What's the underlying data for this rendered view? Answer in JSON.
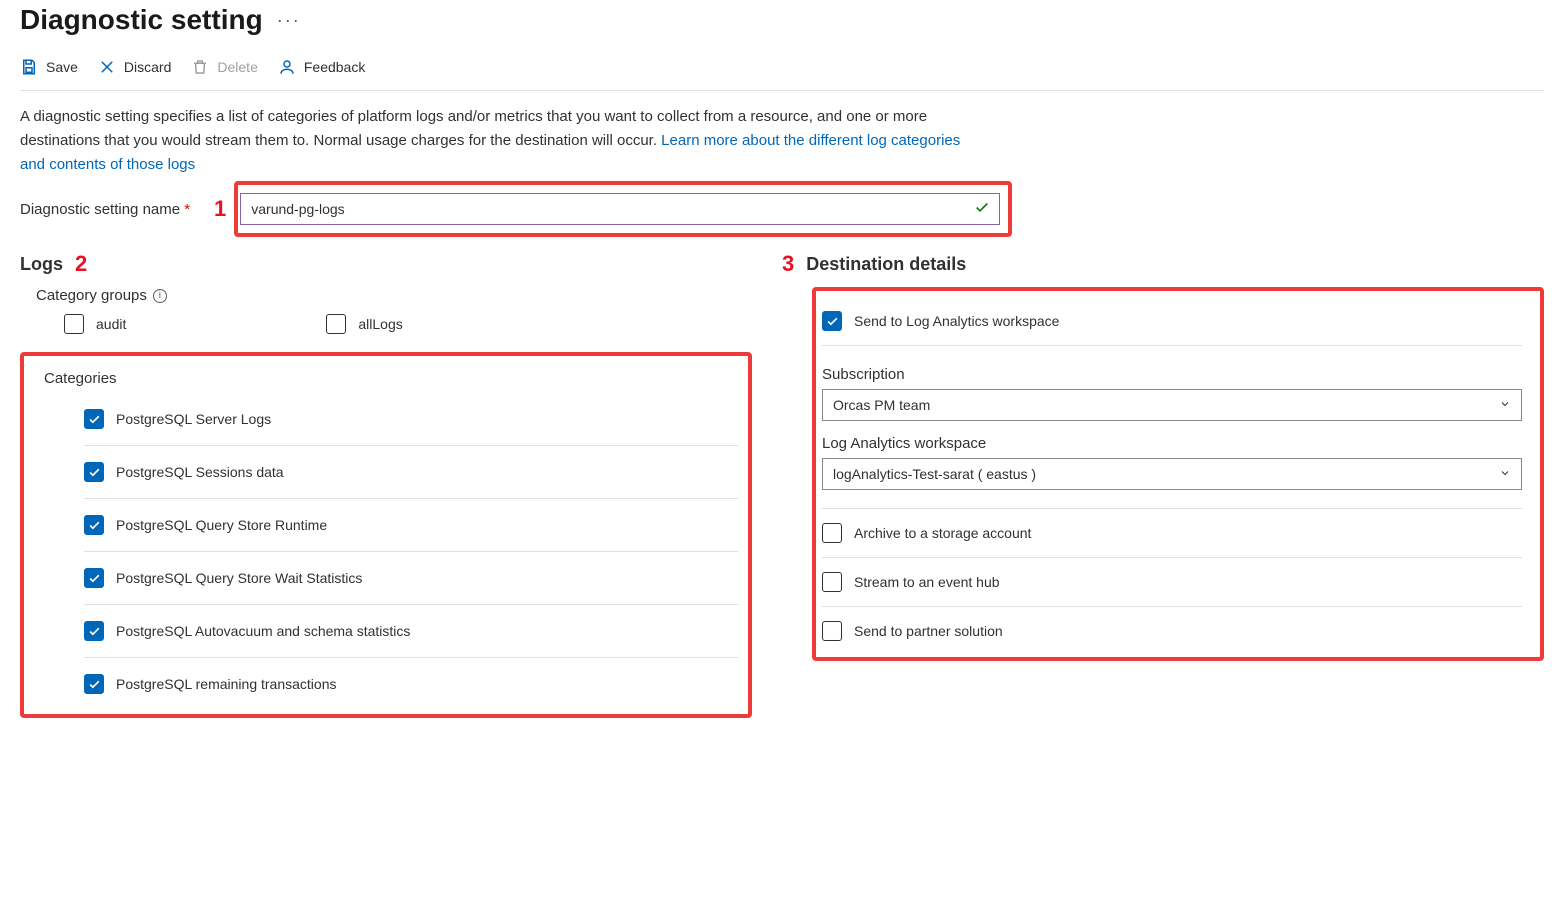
{
  "header": {
    "title": "Diagnostic setting",
    "more": "…"
  },
  "toolbar": {
    "save": "Save",
    "discard": "Discard",
    "delete": "Delete",
    "feedback": "Feedback"
  },
  "description": {
    "text": "A diagnostic setting specifies a list of categories of platform logs and/or metrics that you want to collect from a resource, and one or more destinations that you would stream them to. Normal usage charges for the destination will occur. ",
    "link": "Learn more about the different log categories and contents of those logs"
  },
  "callouts": {
    "one": "1",
    "two": "2",
    "three": "3"
  },
  "name_field": {
    "label": "Diagnostic setting name",
    "value": "varund-pg-logs"
  },
  "logs": {
    "title": "Logs",
    "category_groups_label": "Category groups",
    "groups": {
      "audit": "audit",
      "allLogs": "allLogs"
    },
    "categories_label": "Categories",
    "categories": [
      "PostgreSQL Server Logs",
      "PostgreSQL Sessions data",
      "PostgreSQL Query Store Runtime",
      "PostgreSQL Query Store Wait Statistics",
      "PostgreSQL Autovacuum and schema statistics",
      "PostgreSQL remaining transactions"
    ]
  },
  "destination": {
    "title": "Destination details",
    "log_analytics": "Send to Log Analytics workspace",
    "subscription_label": "Subscription",
    "subscription_value": "Orcas PM team",
    "workspace_label": "Log Analytics workspace",
    "workspace_value": "logAnalytics-Test-sarat ( eastus )",
    "archive": "Archive to a storage account",
    "stream": "Stream to an event hub",
    "partner": "Send to partner solution"
  }
}
